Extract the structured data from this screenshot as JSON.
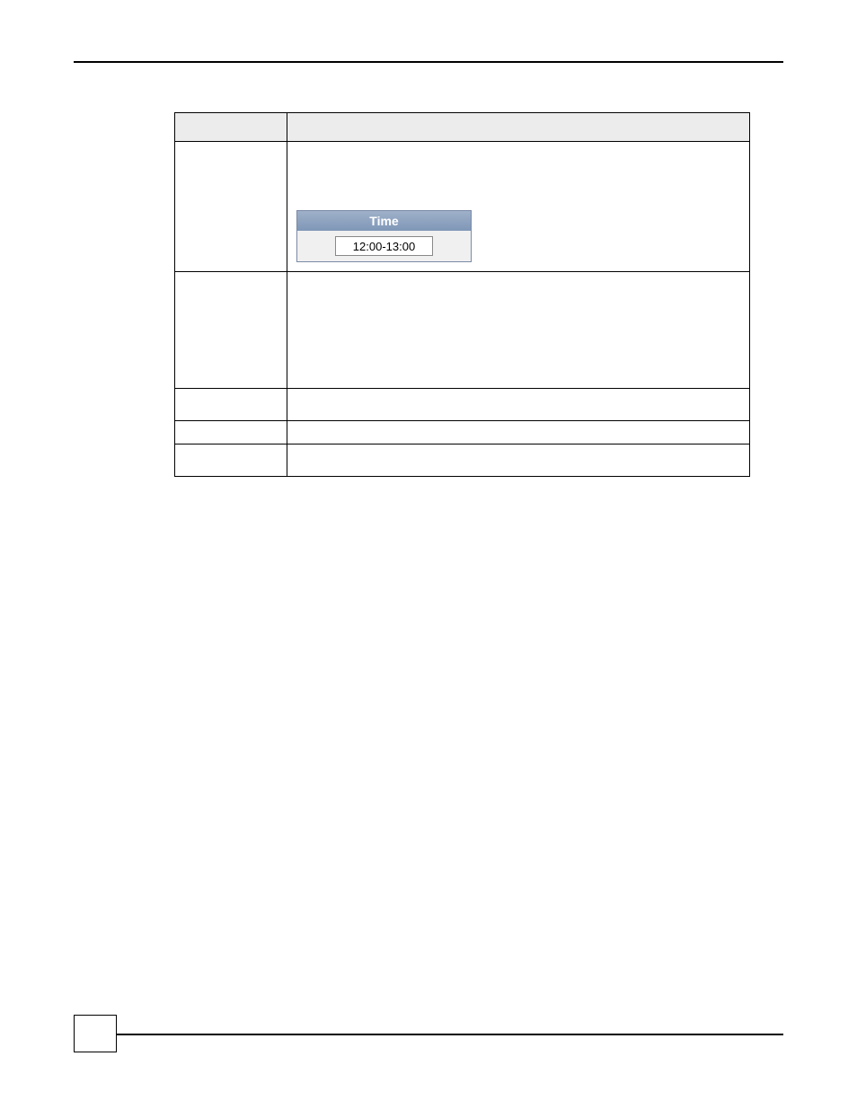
{
  "table": {
    "header": {
      "col1": "",
      "col2": ""
    },
    "rows": [
      {
        "label": "",
        "value": ""
      },
      {
        "label": "",
        "value": ""
      },
      {
        "label": "",
        "value": ""
      },
      {
        "label": "",
        "value": ""
      },
      {
        "label": "",
        "value": ""
      }
    ]
  },
  "time_widget": {
    "title": "Time",
    "value": "12:00-13:00"
  },
  "page_badge": ""
}
